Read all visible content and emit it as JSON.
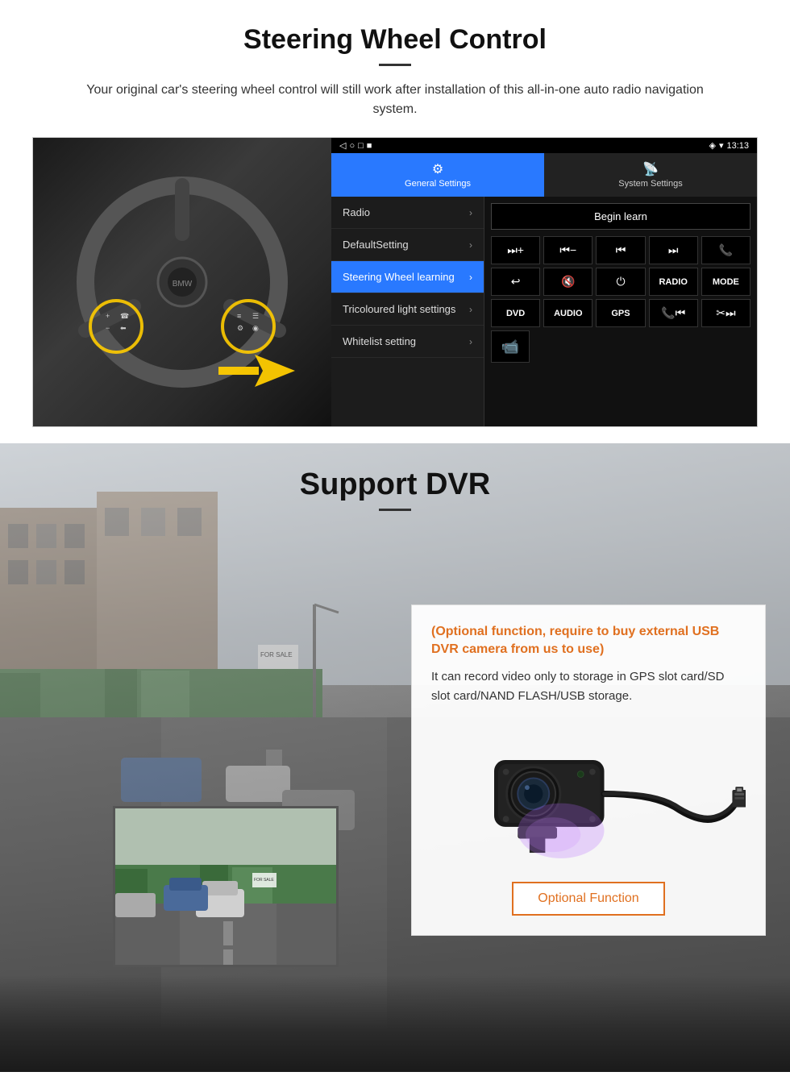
{
  "steering_section": {
    "title": "Steering Wheel Control",
    "subtitle": "Your original car's steering wheel control will still work after installation of this all-in-one auto radio navigation system.",
    "statusbar": {
      "time": "13:13",
      "icons": [
        "◁",
        "○",
        "□",
        "■"
      ]
    },
    "tabs": [
      {
        "label": "General Settings",
        "icon": "⚙",
        "active": true
      },
      {
        "label": "System Settings",
        "icon": "📡",
        "active": false
      }
    ],
    "menu_items": [
      {
        "label": "Radio",
        "active": false
      },
      {
        "label": "DefaultSetting",
        "active": false
      },
      {
        "label": "Steering Wheel learning",
        "active": true
      },
      {
        "label": "Tricoloured light settings",
        "active": false
      },
      {
        "label": "Whitelist setting",
        "active": false
      }
    ],
    "begin_learn_btn": "Begin learn",
    "control_row1": [
      "⏭+",
      "⏮−",
      "⏮⏮",
      "⏭⏭",
      "📞"
    ],
    "control_row2": [
      "↩",
      "🔇×",
      "⏻",
      "RADIO",
      "MODE"
    ],
    "control_row3": [
      "DVD",
      "AUDIO",
      "GPS",
      "📞⏮",
      "✂⏭"
    ],
    "dvr_icon": "📹"
  },
  "dvr_section": {
    "title": "Support DVR",
    "optional_text": "(Optional function, require to buy external USB DVR camera from us to use)",
    "desc_text": "It can record video only to storage in GPS slot card/SD slot card/NAND FLASH/USB storage.",
    "optional_function_btn": "Optional Function"
  }
}
